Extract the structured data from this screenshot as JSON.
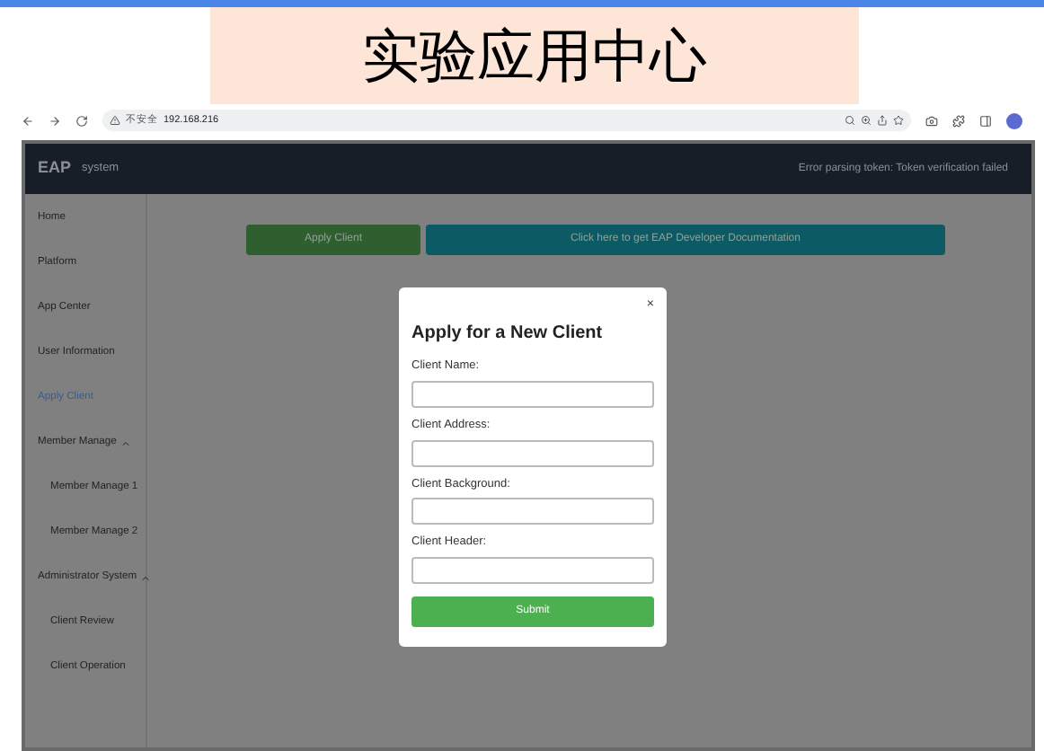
{
  "slide_title": "实验应用中心",
  "browser": {
    "security": "不安全",
    "url": "192.168.216"
  },
  "header": {
    "logo": "EAP",
    "subtitle": "system",
    "error": "Error parsing token: Token verification failed"
  },
  "sidebar": {
    "items": [
      {
        "label": "Home",
        "selected": false
      },
      {
        "label": "Platform",
        "selected": false
      },
      {
        "label": "App Center",
        "selected": false
      },
      {
        "label": "User Information",
        "selected": false
      },
      {
        "label": "Apply Client",
        "selected": true
      },
      {
        "label": "Member Manage",
        "selected": false,
        "expanded": true,
        "children": [
          {
            "label": "Member Manage 1",
            "selected": false
          },
          {
            "label": "Member Manage 2",
            "selected": false
          }
        ]
      },
      {
        "label": "Administrator System",
        "selected": false,
        "expanded": true,
        "children": [
          {
            "label": "Client Review",
            "selected": false
          },
          {
            "label": "Client Operation",
            "selected": false
          }
        ]
      }
    ]
  },
  "actions": [
    {
      "label": "Apply Client",
      "kind": "primary"
    },
    {
      "label": "Click here to get EAP Developer Documentation",
      "kind": "docs"
    }
  ],
  "modal": {
    "title": "Apply for a New Client",
    "close": "×",
    "fields": [
      {
        "label": "Client Name:"
      },
      {
        "label": "Client Address:"
      },
      {
        "label": "Client Background:"
      },
      {
        "label": "Client Header:"
      }
    ],
    "submit": "Submit"
  }
}
